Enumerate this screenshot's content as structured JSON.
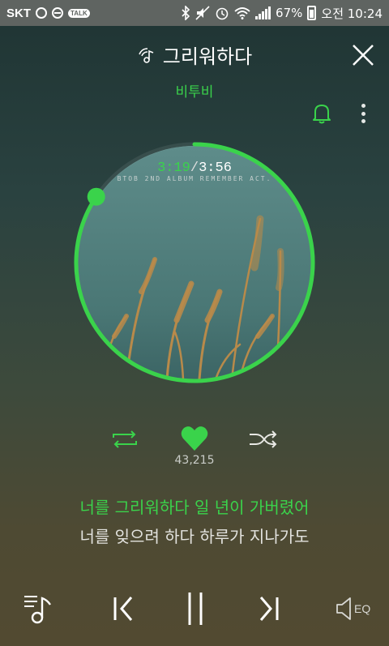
{
  "status_bar": {
    "carrier": "SKT",
    "talk_badge": "TALK",
    "battery_percent": "67%",
    "time": "오전 10:24",
    "battery_level": 0.67
  },
  "player": {
    "song_title": "그리워하다",
    "artist": "비투비",
    "album_art_text": "BTOB 2ND ALBUM  REMEMBER ACT.",
    "current_time": "3:19",
    "separator": "/",
    "total_time": "3:56",
    "progress": 0.844,
    "like_count": "43,215"
  },
  "lyrics": {
    "current_line": "너를 그리워하다 일 년이 가버렸어",
    "next_line": "너를 잊으려 하다 하루가 지나가도"
  },
  "icons": {
    "close": "close-icon",
    "bell": "bell-icon",
    "more": "more-vertical-icon",
    "repeat": "repeat-icon",
    "heart": "heart-icon",
    "shuffle": "shuffle-icon",
    "playlist": "playlist-icon",
    "prev": "previous-icon",
    "pause": "pause-icon",
    "next": "next-icon",
    "eq": "eq-icon"
  },
  "bottom_bar": {
    "eq_label": "EQ"
  },
  "colors": {
    "accent": "#3ad34b",
    "status_bar": "#5f6461"
  }
}
